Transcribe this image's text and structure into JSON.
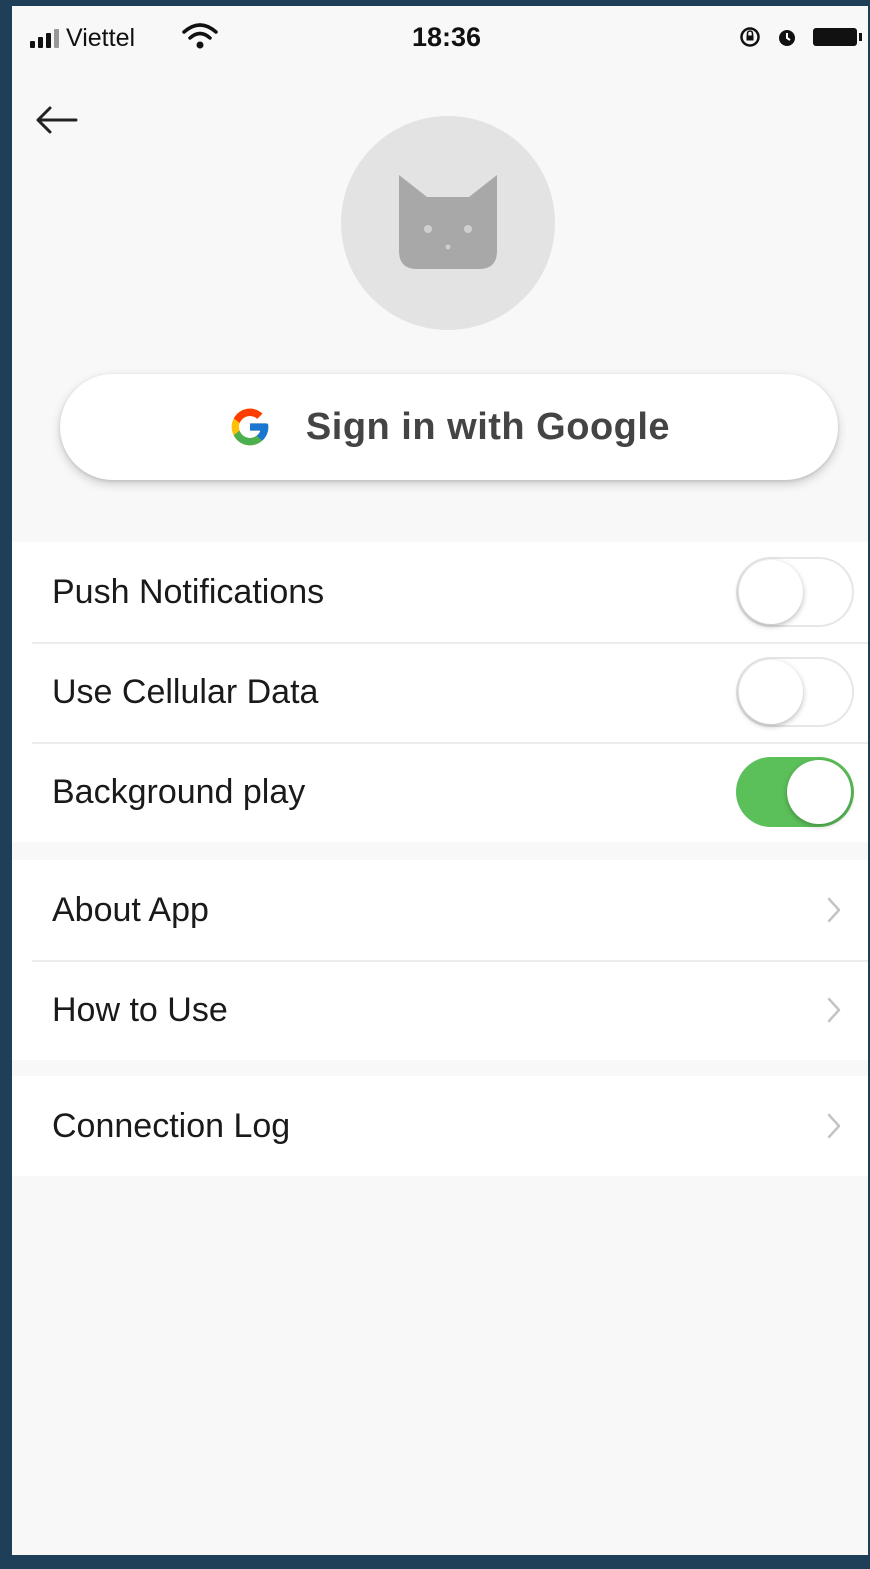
{
  "status_bar": {
    "carrier": "Viettel",
    "time": "18:36",
    "icons": [
      "signal-icon",
      "wifi-icon",
      "rotation-lock-icon",
      "alarm-icon",
      "battery-icon"
    ]
  },
  "nav": {
    "back_icon": "back-arrow-icon"
  },
  "profile": {
    "avatar_icon": "cat-avatar-icon"
  },
  "google_button": {
    "label": "Sign in with Google",
    "icon": "google-icon"
  },
  "settings": {
    "toggles": [
      {
        "label": "Push Notifications",
        "on": false
      },
      {
        "label": "Use Cellular Data",
        "on": false
      },
      {
        "label": "Background play",
        "on": true
      }
    ],
    "links": [
      {
        "label": "About App"
      },
      {
        "label": "How to Use"
      }
    ],
    "links2": [
      {
        "label": "Connection Log"
      }
    ]
  },
  "colors": {
    "toggle_on": "#5cc05a",
    "background": "#f8f8f8",
    "avatar_bg": "#e3e3e3"
  }
}
